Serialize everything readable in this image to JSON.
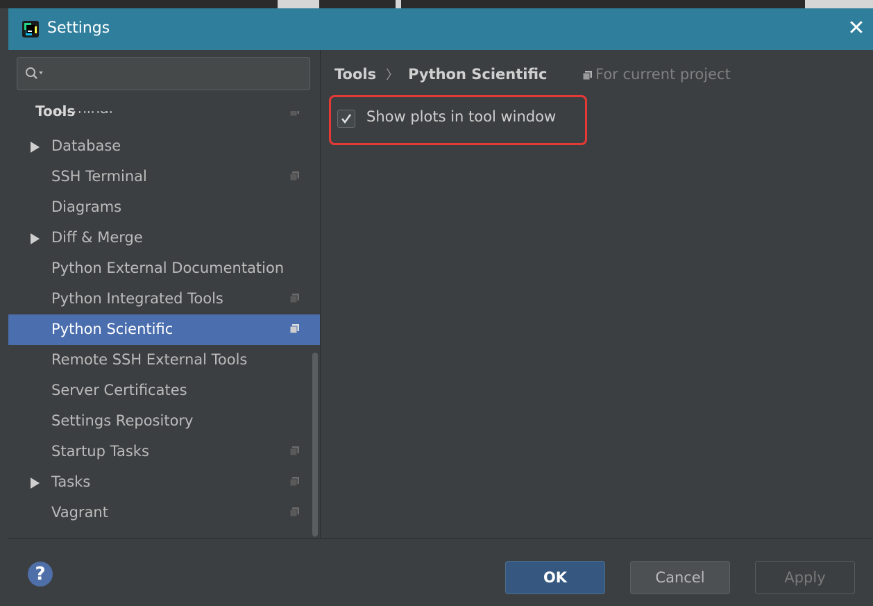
{
  "window": {
    "title": "Settings",
    "close_glyph": "✕"
  },
  "search": {
    "placeholder": ""
  },
  "sidebar": {
    "section_title": "Tools",
    "clipped_item": "Terminal",
    "items": [
      {
        "label": "Database",
        "expandable": true,
        "project_scope": false
      },
      {
        "label": "SSH Terminal",
        "expandable": false,
        "project_scope": true
      },
      {
        "label": "Diagrams",
        "expandable": false,
        "project_scope": false
      },
      {
        "label": "Diff & Merge",
        "expandable": true,
        "project_scope": false
      },
      {
        "label": "Python External Documentation",
        "expandable": false,
        "project_scope": false
      },
      {
        "label": "Python Integrated Tools",
        "expandable": false,
        "project_scope": true
      },
      {
        "label": "Python Scientific",
        "expandable": false,
        "project_scope": true,
        "selected": true
      },
      {
        "label": "Remote SSH External Tools",
        "expandable": false,
        "project_scope": false
      },
      {
        "label": "Server Certificates",
        "expandable": false,
        "project_scope": false
      },
      {
        "label": "Settings Repository",
        "expandable": false,
        "project_scope": false
      },
      {
        "label": "Startup Tasks",
        "expandable": false,
        "project_scope": true
      },
      {
        "label": "Tasks",
        "expandable": true,
        "project_scope": true
      },
      {
        "label": "Vagrant",
        "expandable": false,
        "project_scope": true
      }
    ]
  },
  "main": {
    "breadcrumb": {
      "parent": "Tools",
      "separator": "〉",
      "current": "Python Scientific"
    },
    "scope_note": "For current project",
    "option": {
      "label": "Show plots in tool window",
      "checked": true
    }
  },
  "footer": {
    "help_label": "?",
    "ok_label": "OK",
    "cancel_label": "Cancel",
    "apply_label": "Apply"
  },
  "colors": {
    "titlebar": "#2f7f9c",
    "selection": "#4b6eaf",
    "highlight_box": "#e53935",
    "ok_button": "#365880"
  }
}
